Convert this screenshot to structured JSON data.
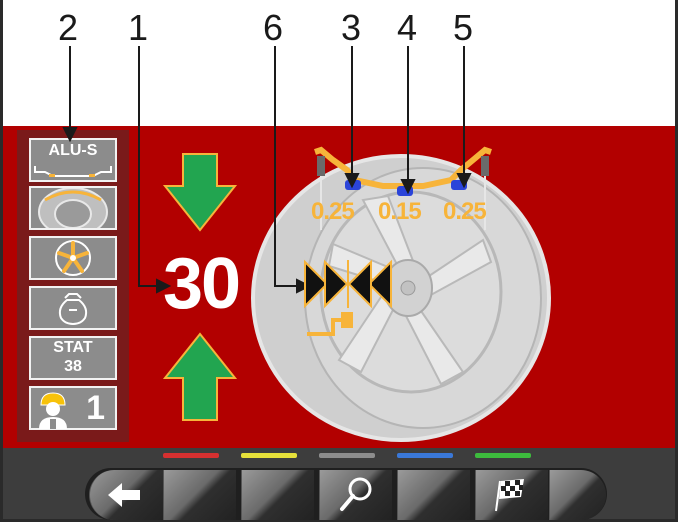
{
  "callouts": [
    "2",
    "1",
    "6",
    "3",
    "4",
    "5"
  ],
  "sidebar": {
    "rim_type": "ALU-S",
    "stat_label": "STAT",
    "stat_value": "38",
    "operator_number": "1"
  },
  "main": {
    "position_value": "30",
    "measurements": [
      "0.25",
      "0.15",
      "0.25"
    ]
  },
  "colors": {
    "panel_red": "#b20000",
    "arrow_green": "#22a550",
    "measurement_orange": "#f7b43a",
    "weight_blue": "#2b44d9",
    "softkey_red": "#d63030",
    "softkey_yellow": "#e6e03a",
    "softkey_gray": "#8d8d8d",
    "softkey_blue": "#3a78d8",
    "softkey_green": "#3dbb3d"
  },
  "toolbar": {
    "buttons": [
      "back-arrow-icon",
      "blank",
      "blank",
      "magnifier-icon",
      "blank",
      "checkered-flag-icon"
    ]
  }
}
